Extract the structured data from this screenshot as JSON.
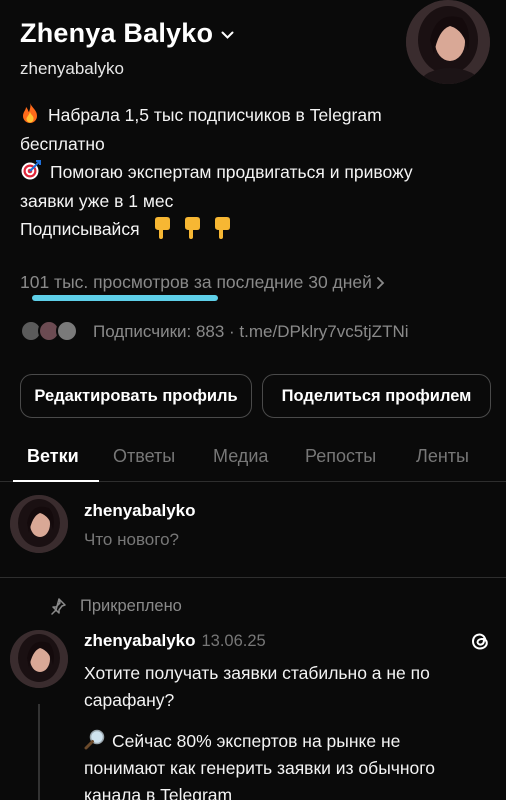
{
  "profile": {
    "display_name": "Zhenya  Balyko",
    "username": "zhenyabalyko",
    "bio_lines": [
      "Набрала 1,5 тыс подписчиков в Telegram",
      "бесплатно",
      "Помогаю экспертам продвигаться и привожу",
      "заявки уже в 1 мес",
      "Подписывайся"
    ],
    "views": "101 тыс. просмотров за последние 30 дней",
    "followers_text": "Подписчики: 883 · t.me/DPklry7vc5tjZTNi"
  },
  "buttons": {
    "edit": "Редактировать профиль",
    "share": "Поделиться профилем"
  },
  "tabs": [
    "Ветки",
    "Ответы",
    "Медиа",
    "Репосты",
    "Ленты"
  ],
  "composer": {
    "username": "zhenyabalyko",
    "placeholder": "Что нового?"
  },
  "pinned_label": "Прикреплено",
  "post": {
    "username": "zhenyabalyko",
    "date": "13.06.25",
    "paragraph1": [
      "Хотите получать заявки стабильно а не по",
      "сарафану?"
    ],
    "paragraph2": [
      "Сейчас 80% экспертов на рынке не",
      "понимают как генерить заявки из обычного",
      "канала в Telegram"
    ]
  },
  "colors": {
    "background": "#0a0a0a",
    "accent_underline": "#5ecfe8",
    "muted_text": "#8a8a8a"
  },
  "icons": [
    "chevron-down-icon",
    "fire-icon",
    "target-icon",
    "pointing-down-icon",
    "chevron-right-icon",
    "pin-icon",
    "threads-logo-icon",
    "magnifier-icon"
  ]
}
